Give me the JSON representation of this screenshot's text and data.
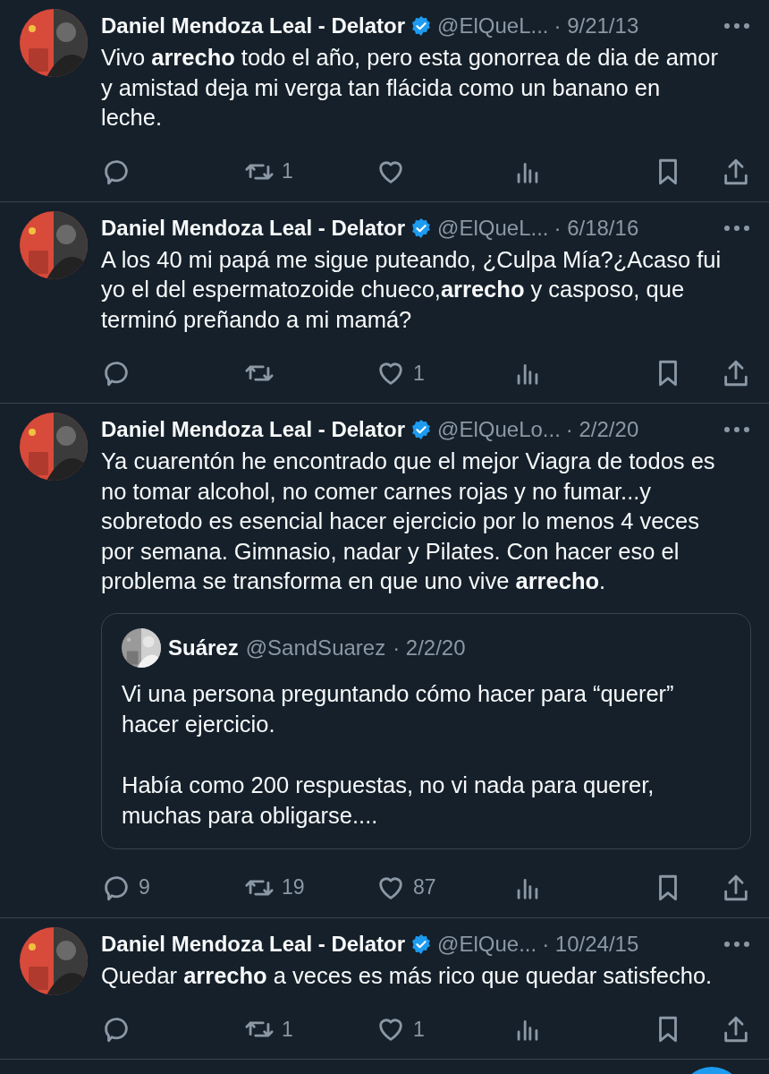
{
  "tweets": [
    {
      "author": "Daniel Mendoza Leal - Delator",
      "verified": true,
      "handle": "@ElQueL...",
      "date": "· 9/21/13",
      "text": "Vivo **arrecho** todo el año, pero esta gonorrea de dia de amor y amistad deja mi verga tan flácida como un banano en leche.",
      "retweets": "1"
    },
    {
      "author": "Daniel Mendoza Leal - Delator",
      "verified": true,
      "handle": "@ElQueL...",
      "date": "· 6/18/16",
      "text": "A los 40 mi papá me sigue puteando, ¿Culpa Mía?¿Acaso fui yo el del espermatozoide chueco,**arrecho** y casposo, que terminó preñando a mi mamá?",
      "likes": "1"
    },
    {
      "author": "Daniel Mendoza Leal - Delator",
      "verified": true,
      "handle": "@ElQueLo...",
      "date": "· 2/2/20",
      "text": "Ya cuarentón he encontrado que el mejor Viagra de todos es no tomar alcohol, no comer carnes rojas y no fumar...y sobretodo es esencial hacer ejercicio por lo menos 4 veces por semana. Gimnasio, nadar y Pilates. Con hacer eso el problema se transforma en que uno vive **arrecho**.",
      "quote": {
        "author": "Suárez",
        "handle": "@SandSuarez",
        "date": "· 2/2/20",
        "paragraphs": [
          "Vi una persona preguntando cómo hacer para “querer” hacer ejercicio.",
          "Había como 200 respuestas, no vi nada para querer, muchas para obligarse...."
        ]
      },
      "replies": "9",
      "retweets": "19",
      "likes": "87"
    },
    {
      "author": "Daniel Mendoza Leal - Delator",
      "verified": true,
      "handle": "@ElQue...",
      "date": "· 10/24/15",
      "text": "Quedar **arrecho** a veces es más rico que quedar satisfecho.",
      "retweets": "1",
      "likes": "1"
    }
  ]
}
